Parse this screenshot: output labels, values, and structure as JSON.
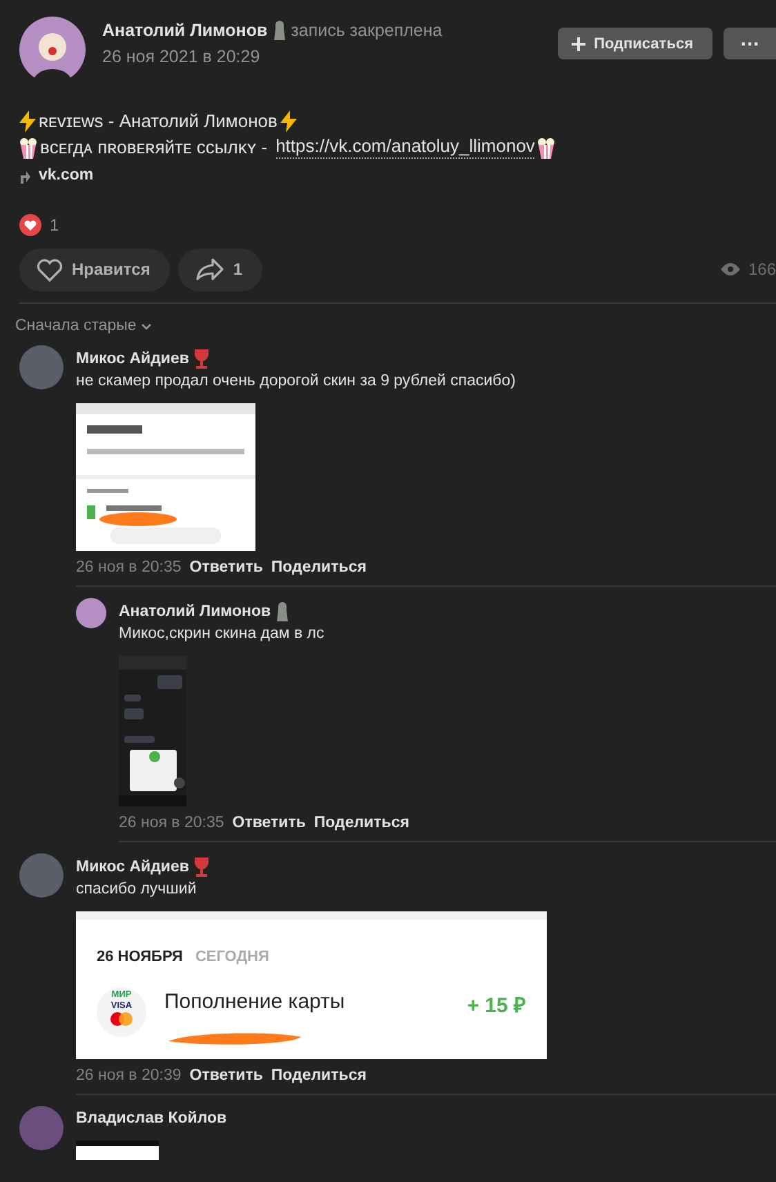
{
  "post": {
    "author": "Анатолий Лимонов",
    "author_badge": {
      "kind": "figure"
    },
    "pinned_note": "запись закреплена",
    "date": "26 ноя 2021 в 20:29",
    "subscribe_button": "Подписаться",
    "more_button": "···",
    "title": "ʀᴇᴠɪᴇᴡs - Анатолий Лимонов",
    "warning": "ʙсᴇгдᴀ пʀоʙᴇʀяйᴛᴇ ссылᴋʏ -",
    "link": "https://vk.com/anatoluy_llimonov",
    "source": "vk.com",
    "reactions_count": "1",
    "like_button": "Нравится",
    "liked": false,
    "share_count": "1",
    "views": "166"
  },
  "sort": "Сначала старые",
  "comments": [
    {
      "author": "Микос Айдиев",
      "avatar": {
        "kind": "anime"
      },
      "badge": {
        "kind": "wine"
      },
      "text": "не скамер продал очень дорогой скин за 9 рублей спасибо)",
      "attachment": {
        "kind": "phone-light"
      },
      "time": "26 ноя в 20:35",
      "reply": "Ответить",
      "share": "Поделиться",
      "children": [
        {
          "author": "Анатолий Лимонов",
          "avatar": {
            "kind": "clown"
          },
          "badge": {
            "kind": "figure"
          },
          "text": "Микос,скрин скина дам в лс",
          "attachment": {
            "kind": "phone-dark"
          },
          "time": "26 ноя в 20:35",
          "reply": "Ответить",
          "share": "Поделиться"
        }
      ]
    },
    {
      "author": "Микос Айдиев",
      "avatar": {
        "kind": "anime"
      },
      "badge": {
        "kind": "wine"
      },
      "text": "спасибо лучший",
      "attachment": {
        "kind": "receipt",
        "date": "26 НОЯБРЯ",
        "day": "СЕГОДНЯ",
        "title": "Пополнение карты",
        "amount": "+ 15 ₽",
        "logos": [
          "МИР",
          "VISA"
        ]
      },
      "time": "26 ноя в 20:39",
      "reply": "Ответить",
      "share": "Поделиться"
    },
    {
      "author": "Владислав Койлов",
      "avatar": {
        "kind": "figure"
      },
      "attachment": {
        "kind": "phone-white"
      }
    }
  ]
}
